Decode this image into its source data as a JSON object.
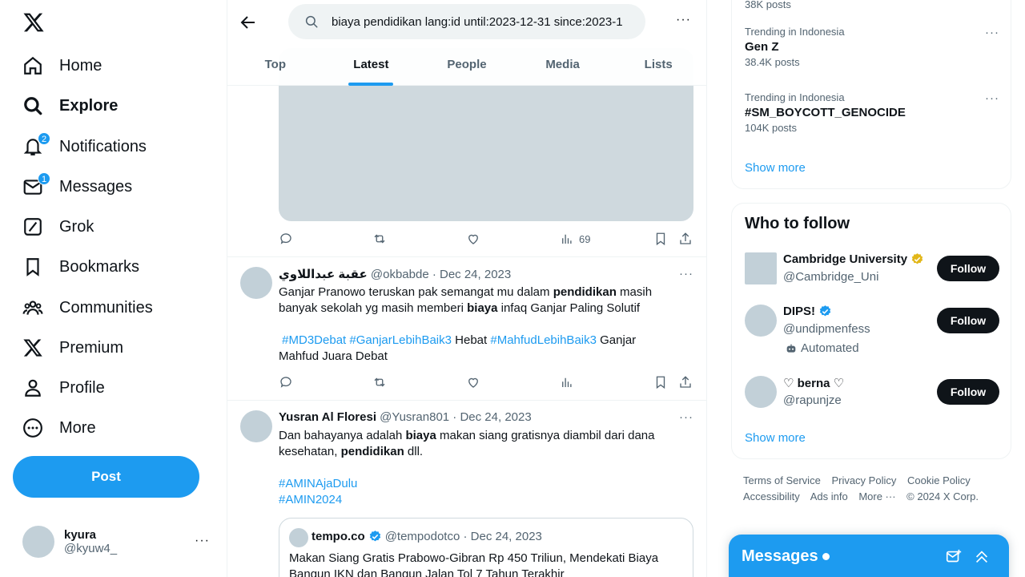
{
  "nav": {
    "items": [
      {
        "label": "Home",
        "icon": "home-icon"
      },
      {
        "label": "Explore",
        "icon": "search-icon"
      },
      {
        "label": "Notifications",
        "icon": "bell-icon",
        "badge": "2"
      },
      {
        "label": "Messages",
        "icon": "mail-icon",
        "badge": "1"
      },
      {
        "label": "Grok",
        "icon": "grok-icon"
      },
      {
        "label": "Bookmarks",
        "icon": "bookmark-icon"
      },
      {
        "label": "Communities",
        "icon": "people-icon"
      },
      {
        "label": "Premium",
        "icon": "x-logo-icon"
      },
      {
        "label": "Profile",
        "icon": "person-icon"
      },
      {
        "label": "More",
        "icon": "more-circle-icon"
      }
    ],
    "post_label": "Post",
    "account": {
      "name": "kyura",
      "handle": "@kyuw4_"
    }
  },
  "search": {
    "query": "biaya pendidikan lang:id until:2023-12-31 since:2023-1",
    "tabs": [
      "Top",
      "Latest",
      "People",
      "Media",
      "Lists"
    ],
    "active_tab": "Latest"
  },
  "first_tweet_actions": {
    "views": "69"
  },
  "tweets": [
    {
      "name": "عقبة عبداللاوي",
      "handle": "@okbabde",
      "date": "Dec 24, 2023",
      "body_parts": {
        "p1": "Ganjar Pranowo teruskan pak semangat mu dalam ",
        "b1": "pendidikan",
        "p2": " masih banyak sekolah yg masih memberi ",
        "b2": "biaya",
        "p3": " infaq Ganjar Paling Solutif",
        "t1": "#MD3Debat",
        "t2": "#GanjarLebihBaik3",
        "p4": " Hebat ",
        "t3": "#MahfudLebihBaik3",
        "p5": " Ganjar Mahfud Juara Debat"
      }
    },
    {
      "name": "Yusran Al Floresi",
      "handle": "@Yusran801",
      "date": "Dec 24, 2023",
      "body_parts": {
        "p1": "Dan bahayanya adalah ",
        "b1": "biaya",
        "p2": " makan siang gratisnya diambil dari dana kesehatan, ",
        "b2": "pendidikan",
        "p3": " dll.",
        "t1": "#AMINAjaDulu",
        "t2": "#AMIN2024"
      },
      "quote": {
        "name": "tempo.co",
        "handle": "@tempodotco",
        "date": "Dec 24, 2023",
        "text": "Makan Siang Gratis Prabowo-Gibran Rp 450 Triliun, Mendekati Biaya Bangun IKN dan Bangun Jalan Tol 7 Tahun Terakhir"
      }
    }
  ],
  "trends": {
    "top_count": "38K posts",
    "items": [
      {
        "context": "Trending in Indonesia",
        "title": "Gen Z",
        "count": "38.4K posts"
      },
      {
        "context": "Trending in Indonesia",
        "title": "#SM_BOYCOTT_GENOCIDE",
        "count": "104K posts"
      }
    ],
    "show_more": "Show more"
  },
  "who_to_follow": {
    "title": "Who to follow",
    "users": [
      {
        "name": "Cambridge University",
        "handle": "@Cambridge_Uni"
      },
      {
        "name": "DIPS!",
        "handle": "@undipmenfess",
        "label": "Automated"
      },
      {
        "name": "♡ berna ♡",
        "handle": "@rapunjze"
      }
    ],
    "follow_label": "Follow",
    "show_more": "Show more"
  },
  "footer": {
    "links": [
      "Terms of Service",
      "Privacy Policy",
      "Cookie Policy",
      "Accessibility",
      "Ads info",
      "More ···"
    ],
    "copyright": "© 2024 X Corp."
  },
  "messages_drawer": {
    "title": "Messages"
  },
  "colors": {
    "accent": "#1d9bf0",
    "text": "#0f1419",
    "muted": "#536471",
    "border": "#eff3f4"
  }
}
